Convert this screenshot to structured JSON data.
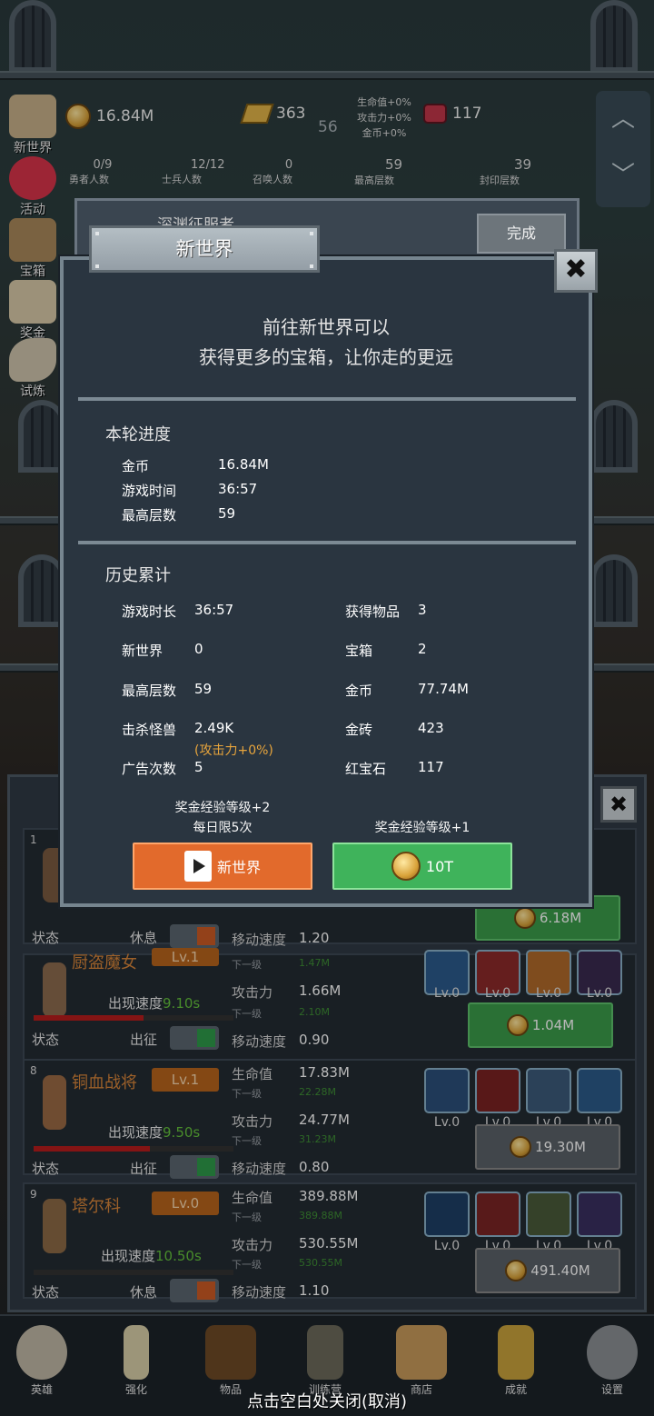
{
  "top_bar": {
    "gold": "16.84M",
    "bricks": "363",
    "bricks_sub": "56",
    "bonus_hp": "生命值+0%",
    "bonus_atk": "攻击力+0%",
    "bonus_gold": "金币+0%",
    "rubies": "117",
    "hero_count": "0/9",
    "hero_count_label": "勇者人数",
    "soldier_count": "12/12",
    "soldier_count_label": "士兵人数",
    "summon_count": "0",
    "summon_count_label": "召唤人数",
    "max_floor": "59",
    "max_floor_label": "最高层数",
    "sealed_floor": "39",
    "sealed_floor_label": "封印层数"
  },
  "side_menu": [
    {
      "label": "新世界",
      "icon": "scroll-map-icon"
    },
    {
      "label": "活动",
      "icon": "heart-icon"
    },
    {
      "label": "宝箱",
      "icon": "chest-icon"
    },
    {
      "label": "奖金",
      "icon": "letter-icon"
    },
    {
      "label": "试炼",
      "icon": "feather-icon"
    }
  ],
  "quest_card": {
    "title": "深渊征服者",
    "done_label": "完成"
  },
  "modal": {
    "title": "新世界",
    "intro_line1": "前往新世界可以",
    "intro_line2": "获得更多的宝箱，让你走的更远",
    "round_title": "本轮进度",
    "round": [
      {
        "label": "金币",
        "value": "16.84M"
      },
      {
        "label": "游戏时间",
        "value": "36:57"
      },
      {
        "label": "最高层数",
        "value": "59"
      }
    ],
    "history_title": "历史累计",
    "history_left": [
      {
        "label": "游戏时长",
        "value": "36:57"
      },
      {
        "label": "新世界",
        "value": "0"
      },
      {
        "label": "最高层数",
        "value": "59"
      },
      {
        "label": "击杀怪兽",
        "value": "2.49K"
      },
      {
        "label": "广告次数",
        "value": "5"
      }
    ],
    "kill_note": "(攻击力+0%)",
    "history_right": [
      {
        "label": "获得物品",
        "value": "3"
      },
      {
        "label": "宝箱",
        "value": "2"
      },
      {
        "label": "金币",
        "value": "77.74M"
      },
      {
        "label": "金砖",
        "value": "423"
      },
      {
        "label": "红宝石",
        "value": "117"
      }
    ],
    "ad_reward_line1": "奖金经验等级+2",
    "ad_reward_line2": "每日限5次",
    "pay_reward": "奖金经验等级+1",
    "ad_button_label": "新世界",
    "pay_button_label": "10T"
  },
  "heroes": [
    {
      "index": "1",
      "name": "",
      "level": "",
      "spawn_label": "",
      "spawn_value": "",
      "state_label": "状态",
      "status": "休息",
      "stats": [
        {
          "label": "移动速度",
          "value": "1.20"
        }
      ],
      "skills": [],
      "upgrade_cost": "6.18M"
    },
    {
      "index": "",
      "name": "厨盗魔女",
      "level": "Lv.1",
      "spawn_label": "出现速度",
      "spawn_value": "9.10s",
      "state_label": "状态",
      "status": "出征",
      "sub_values": [
        "1.47M",
        "2.10M"
      ],
      "stats": [
        {
          "label": "攻击力",
          "value": "1.66M"
        },
        {
          "label": "移动速度",
          "value": "0.90"
        }
      ],
      "sub_label": "下一级",
      "skills": [
        "Lv.0",
        "Lv.0",
        "Lv.0",
        "Lv.0"
      ],
      "upgrade_cost": "1.04M"
    },
    {
      "index": "8",
      "name": "铜血战将",
      "level": "Lv.1",
      "spawn_label": "出现速度",
      "spawn_value": "9.50s",
      "state_label": "状态",
      "status": "出征",
      "stats": [
        {
          "label": "生命值",
          "value": "17.83M",
          "next": "22.28M"
        },
        {
          "label": "攻击力",
          "value": "24.77M",
          "next": "31.23M"
        },
        {
          "label": "移动速度",
          "value": "0.80"
        }
      ],
      "sub_label": "下一级",
      "skills": [
        "Lv.0",
        "Lv.0",
        "Lv.0",
        "Lv.0"
      ],
      "upgrade_cost": "19.30M"
    },
    {
      "index": "9",
      "name": "塔尔科",
      "level": "Lv.0",
      "spawn_label": "出现速度",
      "spawn_value": "10.50s",
      "state_label": "状态",
      "status": "休息",
      "stats": [
        {
          "label": "生命值",
          "value": "389.88M",
          "next": "389.88M"
        },
        {
          "label": "攻击力",
          "value": "530.55M",
          "next": "530.55M"
        },
        {
          "label": "移动速度",
          "value": "1.10"
        }
      ],
      "sub_label": "下一级",
      "skills": [
        "Lv.0",
        "Lv.0",
        "Lv.0",
        "Lv.0"
      ],
      "upgrade_cost": "491.40M"
    }
  ],
  "bottom_nav": [
    {
      "label": "英雄",
      "icon": "skull-icon"
    },
    {
      "label": "强化",
      "icon": "candle-icon"
    },
    {
      "label": "物品",
      "icon": "book-icon"
    },
    {
      "label": "训练营",
      "icon": "lantern-icon"
    },
    {
      "label": "商店",
      "icon": "beer-mug-icon"
    },
    {
      "label": "成就",
      "icon": "key-icon"
    },
    {
      "label": "设置",
      "icon": "gear-icon"
    }
  ],
  "close_hint": "点击空白处关闭(取消)",
  "colors": {
    "accent_orange": "#e26a2c",
    "accent_green": "#3fb35b",
    "panel": "#2a3540",
    "note": "#e8a53c"
  }
}
